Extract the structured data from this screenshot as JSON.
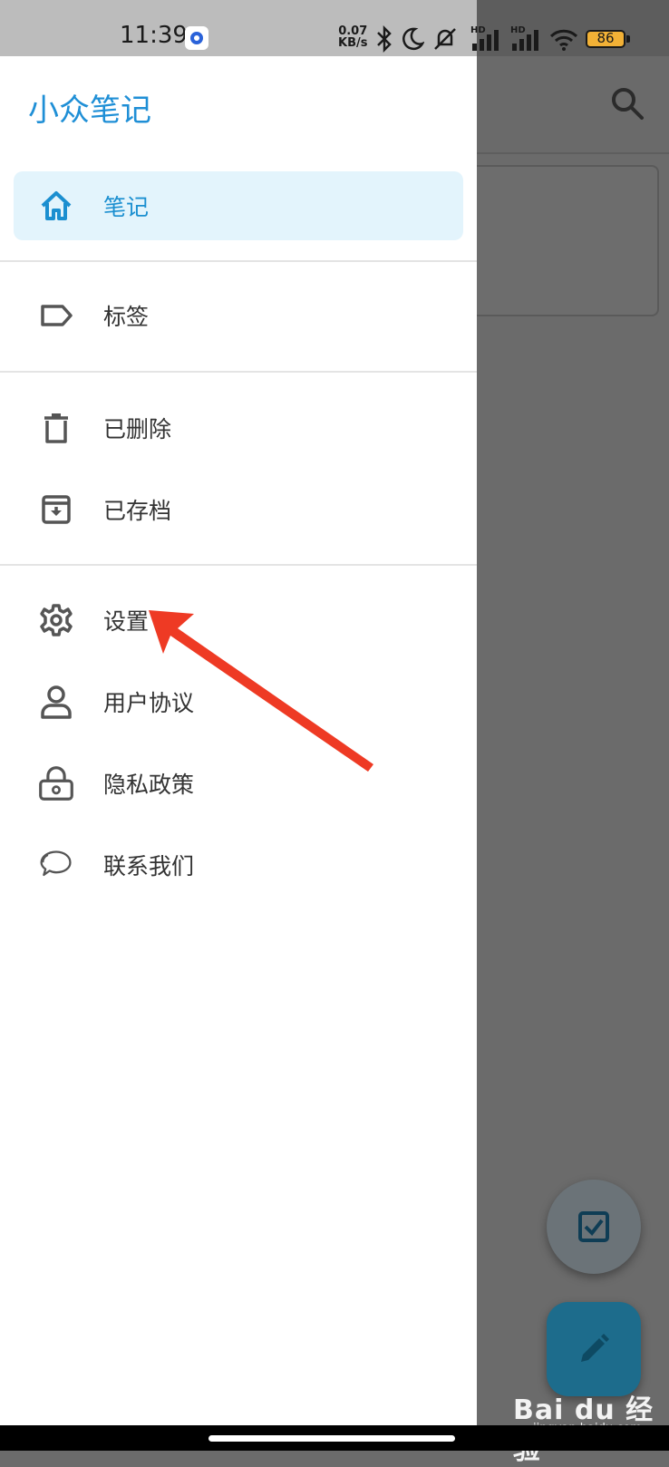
{
  "status_bar": {
    "time": "11:39",
    "net_speed_value": "0.07",
    "net_speed_unit": "KB/s",
    "battery": "86",
    "hd1": "HD",
    "hd2": "HD"
  },
  "drawer": {
    "app_title": "小众笔记",
    "items": [
      {
        "label": "笔记",
        "icon": "home-icon",
        "active": true
      },
      {
        "label": "标签",
        "icon": "label-icon"
      },
      {
        "label": "已删除",
        "icon": "trash-icon"
      },
      {
        "label": "已存档",
        "icon": "archive-icon"
      },
      {
        "label": "设置",
        "icon": "gear-icon"
      },
      {
        "label": "用户协议",
        "icon": "user-icon"
      },
      {
        "label": "隐私政策",
        "icon": "lock-icon"
      },
      {
        "label": "联系我们",
        "icon": "chat-icon"
      }
    ]
  },
  "background": {
    "search_icon": "search-icon",
    "fab_small_icon": "checkbox-icon",
    "fab_big_icon": "pencil-icon"
  },
  "watermark": {
    "brand": "Bai du 经验",
    "url": "jingyan.baidu.com"
  },
  "colors": {
    "accent": "#1f8fd6",
    "active_bg": "#e3f4fc",
    "annotation_arrow": "#ee3a24",
    "fab": "#1d6c8c"
  }
}
